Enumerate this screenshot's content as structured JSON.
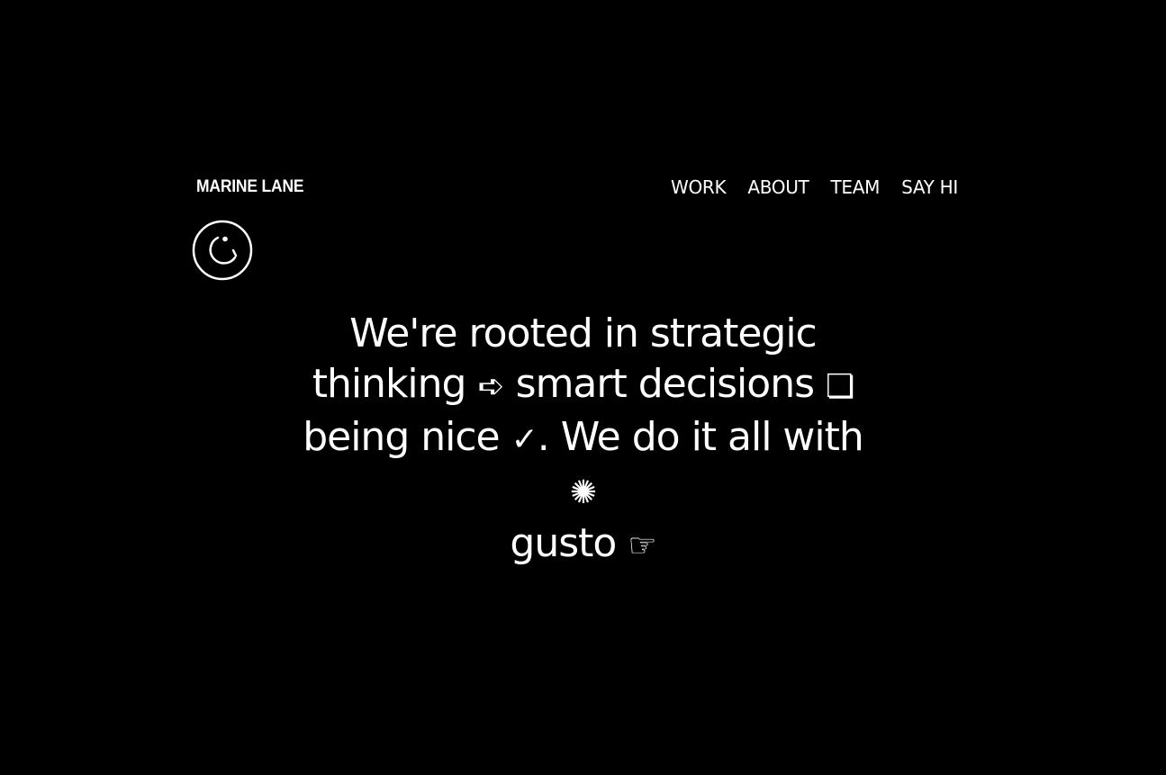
{
  "header": {
    "brand": "MARINE LANE",
    "nav": [
      {
        "label": "WORK"
      },
      {
        "label": "ABOUT"
      },
      {
        "label": "TEAM"
      },
      {
        "label": "SAY HI"
      }
    ],
    "logo_icon": "smiley-circle-icon"
  },
  "hero": {
    "line_1": "We're rooted in strategic",
    "line_2_text": "thinking",
    "line_2_glyph": "➪",
    "line_2_text_b": "smart decisions",
    "line_2_glyph_b": "❏",
    "line_3_text": "being nice",
    "line_3_glyph": "✓",
    "line_3_text_b": ". We do it all with",
    "line_3_glyph_b": "✺",
    "line_4_text": "gusto",
    "line_4_glyph": "☞"
  },
  "colors": {
    "background": "#000000",
    "foreground": "#ffffff"
  }
}
